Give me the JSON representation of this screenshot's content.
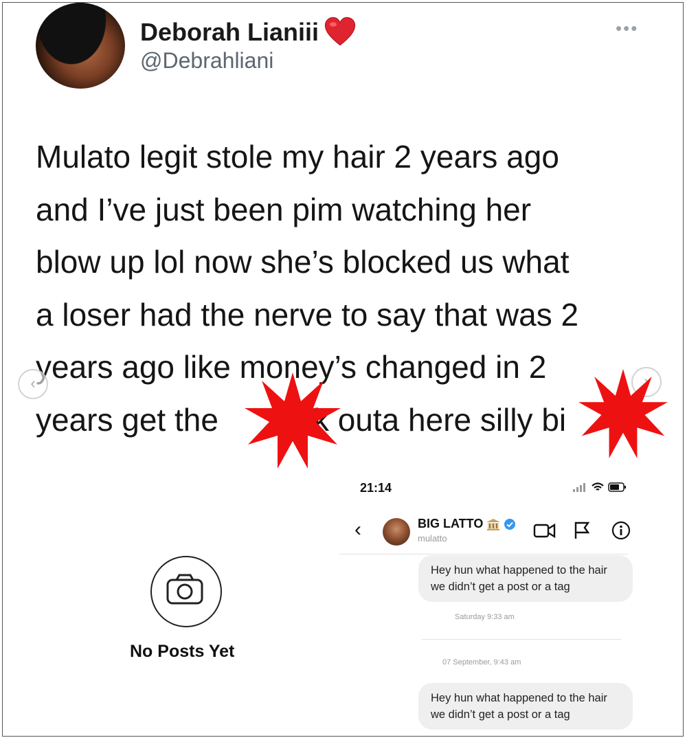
{
  "tweet": {
    "display_name": "Deborah Lianiii",
    "handle": "@Debrahliani",
    "lines": [
      "Mulato legit stole my hair 2 years ago",
      "and I’ve just been pim watching her",
      "blow up lol now she’s blocked us what",
      "a loser had the nerve to say that was 2",
      "years ago like money’s changed in 2",
      "years get the",
      "k outa here silly bi"
    ],
    "more_icon": "more-dots-icon",
    "heart_icon": "red-heart-emoji",
    "censor_color": "#ee1111"
  },
  "profile": {
    "empty_label": "No Posts Yet",
    "icon": "camera-icon"
  },
  "dm": {
    "time": "21:14",
    "contact_name": "BIG LATTO",
    "contact_username": "mulatto",
    "verified_color": "#3797f0",
    "messages": [
      {
        "text": "Hey hun what happened to the hair we didn’t get a post or a tag"
      },
      {
        "text": "Hey hun what happened to the hair we didn’t get a post or a tag"
      }
    ],
    "stamps": [
      "Saturday 9:33 am",
      "07 September, 9:43 am"
    ]
  }
}
